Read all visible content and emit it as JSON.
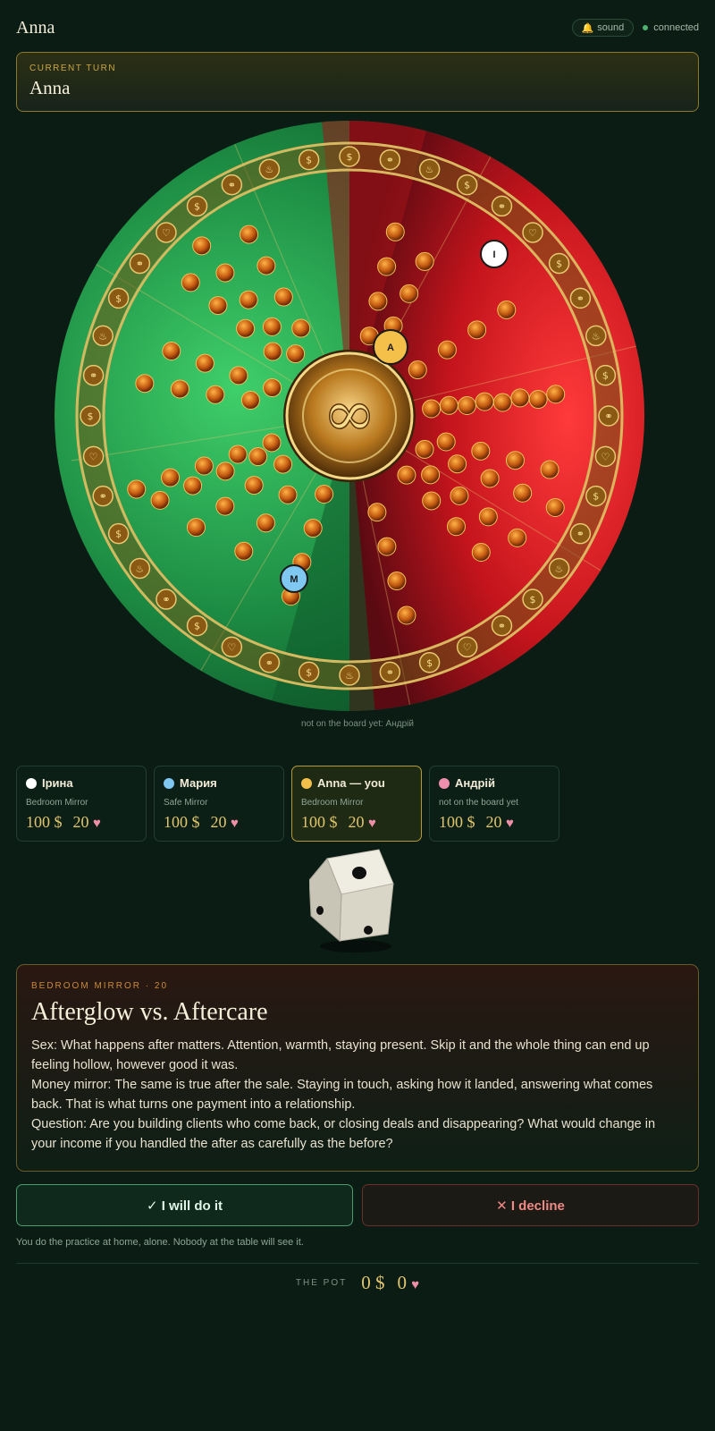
{
  "header": {
    "app_name": "Anna",
    "sound_label": "sound",
    "connection_label": "connected"
  },
  "turn": {
    "label": "CURRENT TURN",
    "player": "Anna"
  },
  "board": {
    "not_on_board_text": "not on the board yet: Андрій",
    "tokens": [
      {
        "letter": "A",
        "color": "#f4c04a"
      },
      {
        "letter": "I",
        "color": "#ffffff"
      },
      {
        "letter": "M",
        "color": "#7fc8f2"
      }
    ]
  },
  "players": [
    {
      "name": "Ірина",
      "status": "Bedroom Mirror",
      "money": "100 $",
      "hearts": "20",
      "color": "#ffffff",
      "is_me": false
    },
    {
      "name": "Мария",
      "status": "Safe Mirror",
      "money": "100 $",
      "hearts": "20",
      "color": "#7fc8f2",
      "is_me": false
    },
    {
      "name": "Anna — you",
      "status": "Bedroom Mirror",
      "money": "100 $",
      "hearts": "20",
      "color": "#f4c04a",
      "is_me": true
    },
    {
      "name": "Андрій",
      "status": "not on the board yet",
      "money": "100 $",
      "hearts": "20",
      "color": "#ef8fae",
      "is_me": false
    }
  ],
  "dice": {
    "value": 3
  },
  "card": {
    "kicker": "BEDROOM MIRROR · 20",
    "title": "Afterglow vs. Aftercare",
    "lines": [
      "Sex: What happens after matters. Attention, warmth, staying present. Skip it and the whole thing can end up feeling hollow, however good it was.",
      "Money mirror: The same is true after the sale. Staying in touch, asking how it landed, answering what comes back. That is what turns one payment into a relationship.",
      "Question: Are you building clients who come back, or closing deals and disappearing? What would change in your income if you handled the after as carefully as the before?"
    ]
  },
  "actions": {
    "accept": "✓ I will do it",
    "decline": "✕ I decline",
    "hint": "You do the practice at home, alone. Nobody at the table will see it."
  },
  "pot": {
    "label": "THE POT",
    "money": "0 $",
    "hearts": "0"
  },
  "colors": {
    "background": "#0b1c14",
    "gold": "#e1c56a",
    "accept_border": "#4f9a6d",
    "decline_text": "#f08a86",
    "heart": "#ee8fa6"
  }
}
